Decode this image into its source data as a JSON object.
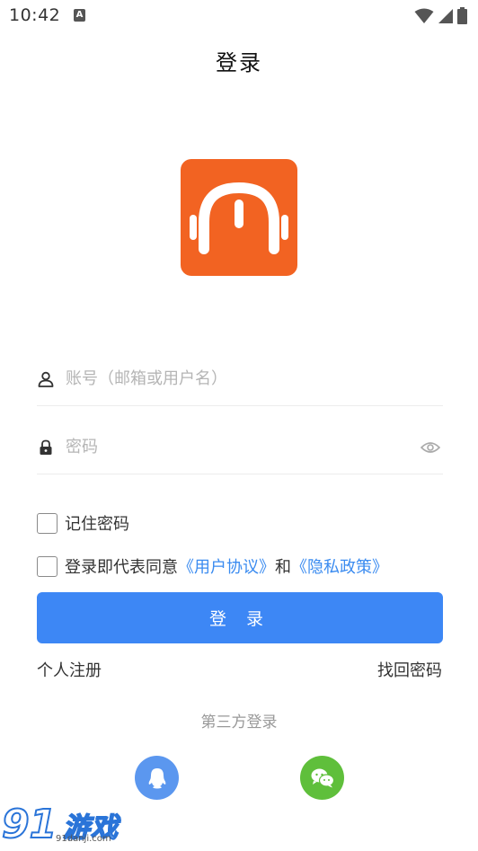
{
  "status_bar": {
    "time": "10:42",
    "notification_icon": "A"
  },
  "page": {
    "title": "登录"
  },
  "form": {
    "account_placeholder": "账号（邮箱或用户名）",
    "account_value": "",
    "password_placeholder": "密码",
    "password_value": "",
    "remember_label": "记住密码",
    "agreement_prefix": "登录即代表同意",
    "user_agreement": "《用户协议》",
    "and": "和",
    "privacy_policy": "《隐私政策》",
    "login_button": "登 录"
  },
  "links": {
    "register": "个人注册",
    "forgot": "找回密码"
  },
  "third_party": {
    "title": "第三方登录"
  },
  "watermark": {
    "logo_num": "91",
    "logo_text": "游戏",
    "url": "91danji.com"
  },
  "colors": {
    "brand_orange": "#f26322",
    "primary_blue": "#3d87f5",
    "link_blue": "#3a8bf0",
    "qq_blue": "#5b97ef",
    "wechat_green": "#5fbf3b"
  },
  "icons": {
    "user": "user-icon",
    "lock": "lock-icon",
    "eye": "eye-icon",
    "qq": "qq-icon",
    "wechat": "wechat-icon",
    "wifi": "wifi-icon",
    "signal": "signal-icon",
    "battery": "battery-icon",
    "logo": "headphones-icon"
  }
}
